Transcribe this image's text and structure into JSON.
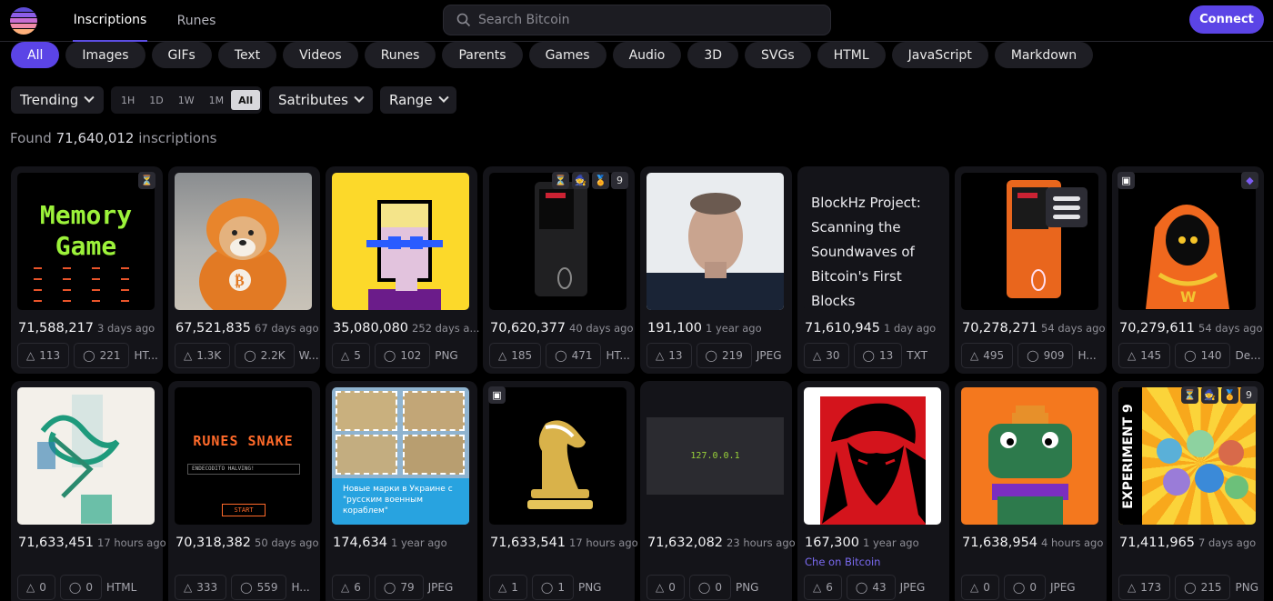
{
  "nav": {
    "tab_inscriptions": "Inscriptions",
    "tab_runes": "Runes",
    "search_placeholder": "Search Bitcoin",
    "connect_label": "Connect"
  },
  "filters": [
    "All",
    "Images",
    "GIFs",
    "Text",
    "Videos",
    "Runes",
    "Parents",
    "Games",
    "Audio",
    "3D",
    "SVGs",
    "HTML",
    "JavaScript",
    "Markdown"
  ],
  "controls": {
    "sort": "Trending",
    "times": [
      "1H",
      "1D",
      "1W",
      "1M",
      "All"
    ],
    "active_time": "All",
    "satributes": "Satributes",
    "range": "Range"
  },
  "results": {
    "prefix": "Found",
    "count": "71,640,012",
    "suffix": "inscriptions"
  },
  "thumb_text": {
    "memory_title_1": "Memory",
    "memory_title_2": "Game",
    "blockhz": "BlockHz Project: Scanning the Soundwaves of Bitcoin's First Blocks",
    "snake_title": "RUNES SNAKE",
    "snake_input": "ENDECODITO HALVING!",
    "snake_start": "START",
    "stamps_caption": "Новые марки в Украине с \"русским военным кораблем\"",
    "ip": "127.0.0.1",
    "experiment": "EXPERIMENT 9"
  },
  "cards": [
    {
      "id": "71,588,217",
      "age": "3 days ago",
      "likes": "113",
      "comments": "221",
      "type": "HT..."
    },
    {
      "id": "67,521,835",
      "age": "67 days ago",
      "likes": "1.3K",
      "comments": "2.2K",
      "type": "W..."
    },
    {
      "id": "35,080,080",
      "age": "252 days a...",
      "likes": "5",
      "comments": "102",
      "type": "PNG"
    },
    {
      "id": "70,620,377",
      "age": "40 days ago",
      "likes": "185",
      "comments": "471",
      "type": "HT..."
    },
    {
      "id": "191,100",
      "age": "1 year ago",
      "likes": "13",
      "comments": "219",
      "type": "JPEG"
    },
    {
      "id": "71,610,945",
      "age": "1 day ago",
      "likes": "30",
      "comments": "13",
      "type": "TXT"
    },
    {
      "id": "70,278,271",
      "age": "54 days ago",
      "likes": "495",
      "comments": "909",
      "type": "H..."
    },
    {
      "id": "70,279,611",
      "age": "54 days ago",
      "likes": "145",
      "comments": "140",
      "type": "De..."
    },
    {
      "id": "71,633,451",
      "age": "17 hours ago",
      "likes": "0",
      "comments": "0",
      "type": "HTML"
    },
    {
      "id": "70,318,382",
      "age": "50 days ago",
      "likes": "333",
      "comments": "559",
      "type": "H..."
    },
    {
      "id": "174,634",
      "age": "1 year ago",
      "likes": "6",
      "comments": "79",
      "type": "JPEG"
    },
    {
      "id": "71,633,541",
      "age": "17 hours ago",
      "likes": "1",
      "comments": "1",
      "type": "PNG"
    },
    {
      "id": "71,632,082",
      "age": "23 hours ago",
      "likes": "0",
      "comments": "0",
      "type": "PNG"
    },
    {
      "id": "167,300",
      "age": "1 year ago",
      "likes": "6",
      "comments": "43",
      "type": "JPEG",
      "extra": "Che on Bitcoin"
    },
    {
      "id": "71,638,954",
      "age": "4 hours ago",
      "likes": "0",
      "comments": "0",
      "type": "JPEG"
    },
    {
      "id": "71,411,965",
      "age": "7 days ago",
      "likes": "173",
      "comments": "215",
      "type": "PNG"
    }
  ]
}
